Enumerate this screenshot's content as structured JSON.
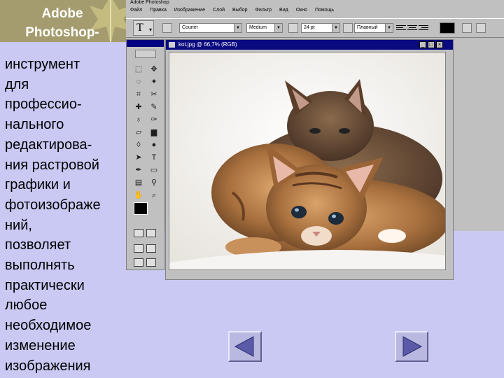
{
  "slide": {
    "title_lines": [
      "Adobe",
      "Photoshop-"
    ],
    "description_lines": [
      "инструмент",
      "для",
      "профессио-",
      "нального",
      "редактирова-",
      "ния растровой",
      "графики и",
      "фотоизображе",
      "ний,",
      "позволяет",
      "выполнять",
      "практически",
      "любое",
      "необходимое",
      "изменение",
      "изображения"
    ]
  },
  "photoshop": {
    "app_title": "Adobe Photoshop",
    "menu": [
      "Файл",
      "Правка",
      "Изображение",
      "Слой",
      "Выбор",
      "Фильтр",
      "Вид",
      "Окно",
      "Помощь"
    ],
    "options": {
      "tool_glyph": "T",
      "font_family": "Courier",
      "font_style": "Medium",
      "font_size": "24 pt",
      "antialias": "Плавный"
    },
    "document": {
      "title": "kot.jpg @ 66,7% (RGB)"
    }
  },
  "colors": {
    "slide_bg": "#c9c9f4",
    "title_band": "#a49c6e",
    "window_gray": "#c0c0c0",
    "title_blue": "#0a0a80"
  }
}
